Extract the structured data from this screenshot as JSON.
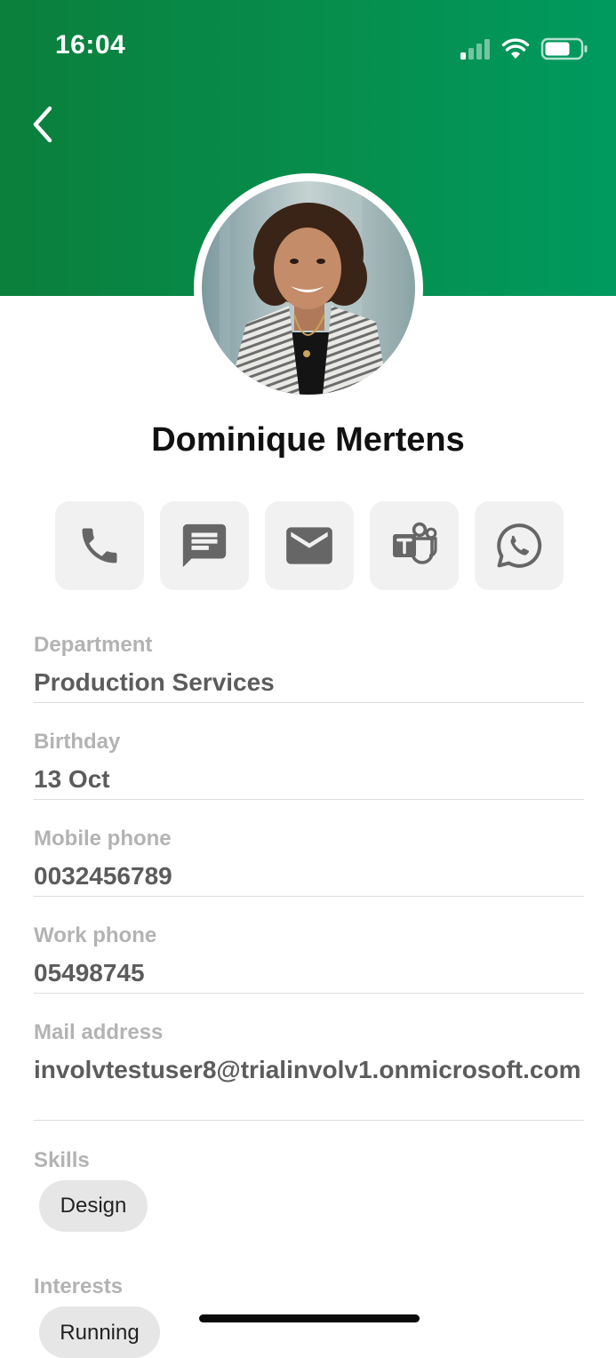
{
  "status_bar": {
    "time": "16:04"
  },
  "colors": {
    "header_start": "#0b7f3c",
    "header_end": "#009a5f",
    "action_bg": "#f1f1f1",
    "action_icon": "#666666",
    "chip_bg": "#e6e6e6"
  },
  "profile": {
    "name": "Dominique Mertens"
  },
  "actions": [
    {
      "icon": "phone-icon"
    },
    {
      "icon": "message-icon"
    },
    {
      "icon": "mail-icon"
    },
    {
      "icon": "teams-icon"
    },
    {
      "icon": "whatsapp-icon"
    }
  ],
  "fields": {
    "department": {
      "label": "Department",
      "value": "Production Services"
    },
    "birthday": {
      "label": "Birthday",
      "value": "13 Oct"
    },
    "mobile_phone": {
      "label": "Mobile phone",
      "value": "0032456789"
    },
    "work_phone": {
      "label": "Work phone",
      "value": "05498745"
    },
    "mail_address": {
      "label": "Mail address",
      "value": "involvtestuser8@trialinvolv1.onmicrosoft.com"
    }
  },
  "skills": {
    "label": "Skills",
    "items": [
      "Design"
    ]
  },
  "interests": {
    "label": "Interests",
    "items": [
      "Running"
    ]
  }
}
